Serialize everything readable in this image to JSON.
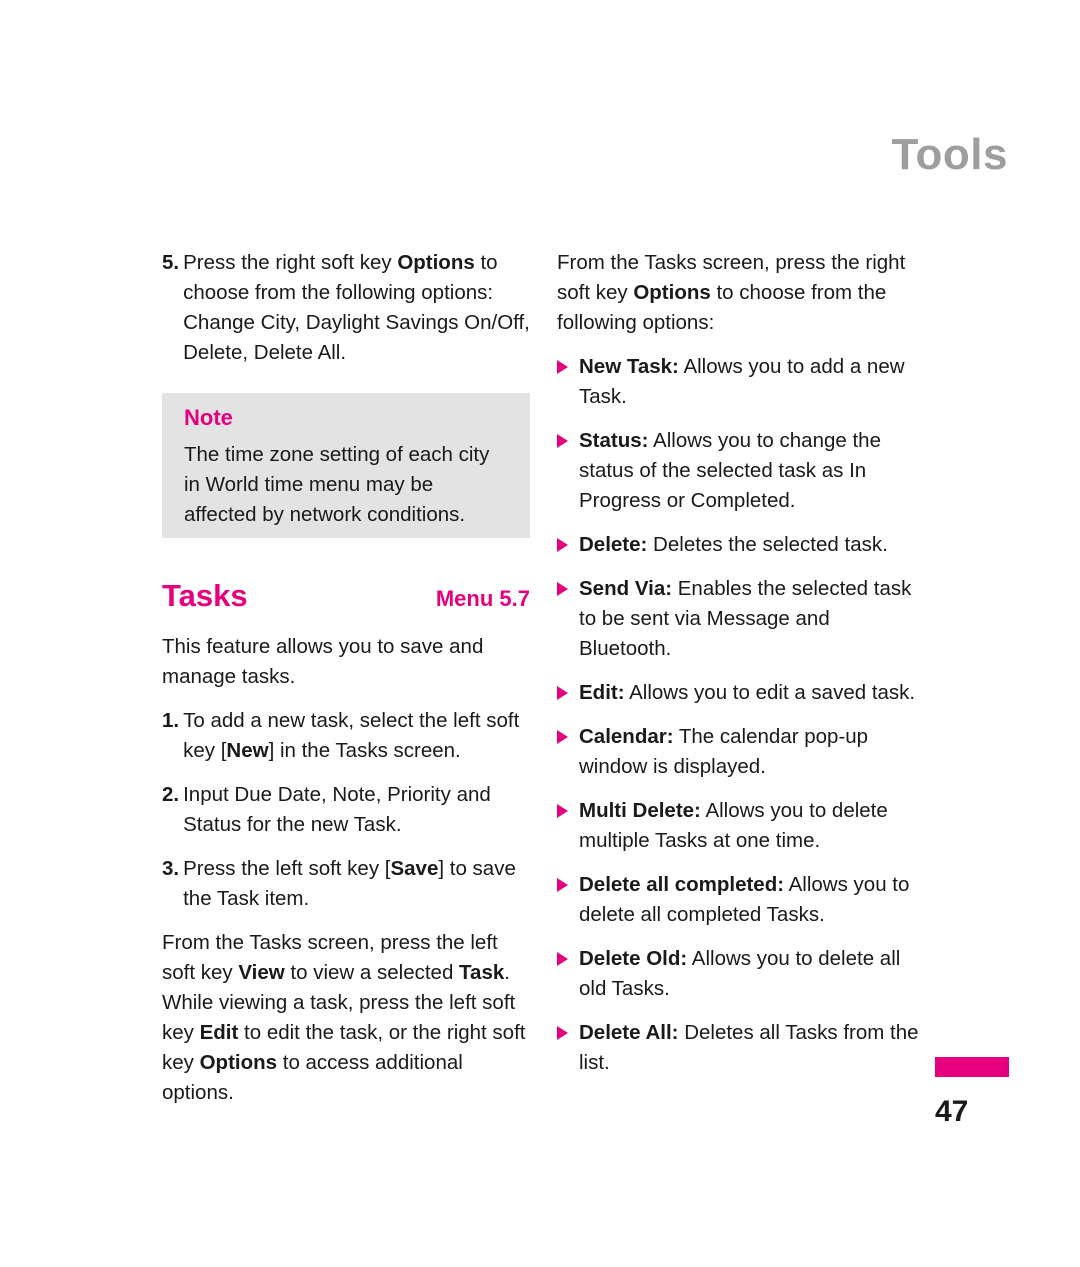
{
  "header": {
    "title": "Tools"
  },
  "left_column": {
    "step5": {
      "num": "5.",
      "text_a": "Press the right soft key ",
      "bold_a": "Options",
      "text_b": " to choose from the following options: Change City, Daylight Savings On/Off, Delete, Delete All."
    },
    "note": {
      "title": "Note",
      "text": "The time zone setting of each city in World time menu may be affected by network conditions."
    },
    "section": {
      "title": "Tasks",
      "menu": "Menu 5.7"
    },
    "intro": "This feature allows you to save and manage tasks.",
    "step1": {
      "num": "1.",
      "text_a": "To add a new task, select the left soft key [",
      "bold_a": "New",
      "text_b": "] in the Tasks screen."
    },
    "step2": {
      "num": "2.",
      "text_a": "Input Due Date, Note, Priority and Status for the new Task."
    },
    "step3": {
      "num": "3.",
      "text_a": "Press the left soft key [",
      "bold_a": "Save",
      "text_b": "] to save the Task item."
    },
    "closing": {
      "text_a": "From the Tasks screen, press the left soft key ",
      "bold_a": "View",
      "text_b": " to view a selected ",
      "bold_b": "Task",
      "text_c": ". While viewing a task, press the left soft key ",
      "bold_c": "Edit",
      "text_d": " to edit the task, or the right soft key ",
      "bold_d": "Options",
      "text_e": " to access additional options."
    }
  },
  "right_column": {
    "intro": {
      "text_a": "From the Tasks screen, press the right soft key ",
      "bold_a": "Options",
      "text_b": " to choose from the following options:"
    },
    "bullets": [
      {
        "label": "New Task:",
        "text": " Allows you to add a new Task."
      },
      {
        "label": "Status:",
        "text": " Allows you to change the status of the selected task as In Progress or Completed."
      },
      {
        "label": "Delete:",
        "text": " Deletes the selected task."
      },
      {
        "label": "Send Via:",
        "text": " Enables the selected task to be sent via Message and Bluetooth."
      },
      {
        "label": "Edit:",
        "text": " Allows you to edit a saved task."
      },
      {
        "label": "Calendar:",
        "text": " The calendar pop-up window is displayed."
      },
      {
        "label": "Multi Delete:",
        "text": " Allows you to delete multiple Tasks at one time."
      },
      {
        "label": "Delete all completed:",
        "text": " Allows you to delete all completed Tasks."
      },
      {
        "label": "Delete Old:",
        "text": " Allows you to delete all old Tasks."
      },
      {
        "label": "Delete All:",
        "text": " Deletes all Tasks from the list."
      }
    ]
  },
  "footer": {
    "page_number": "47"
  },
  "colors": {
    "accent": "#e6007e",
    "header_gray": "#9e9e9e",
    "note_bg": "#e3e3e3"
  }
}
